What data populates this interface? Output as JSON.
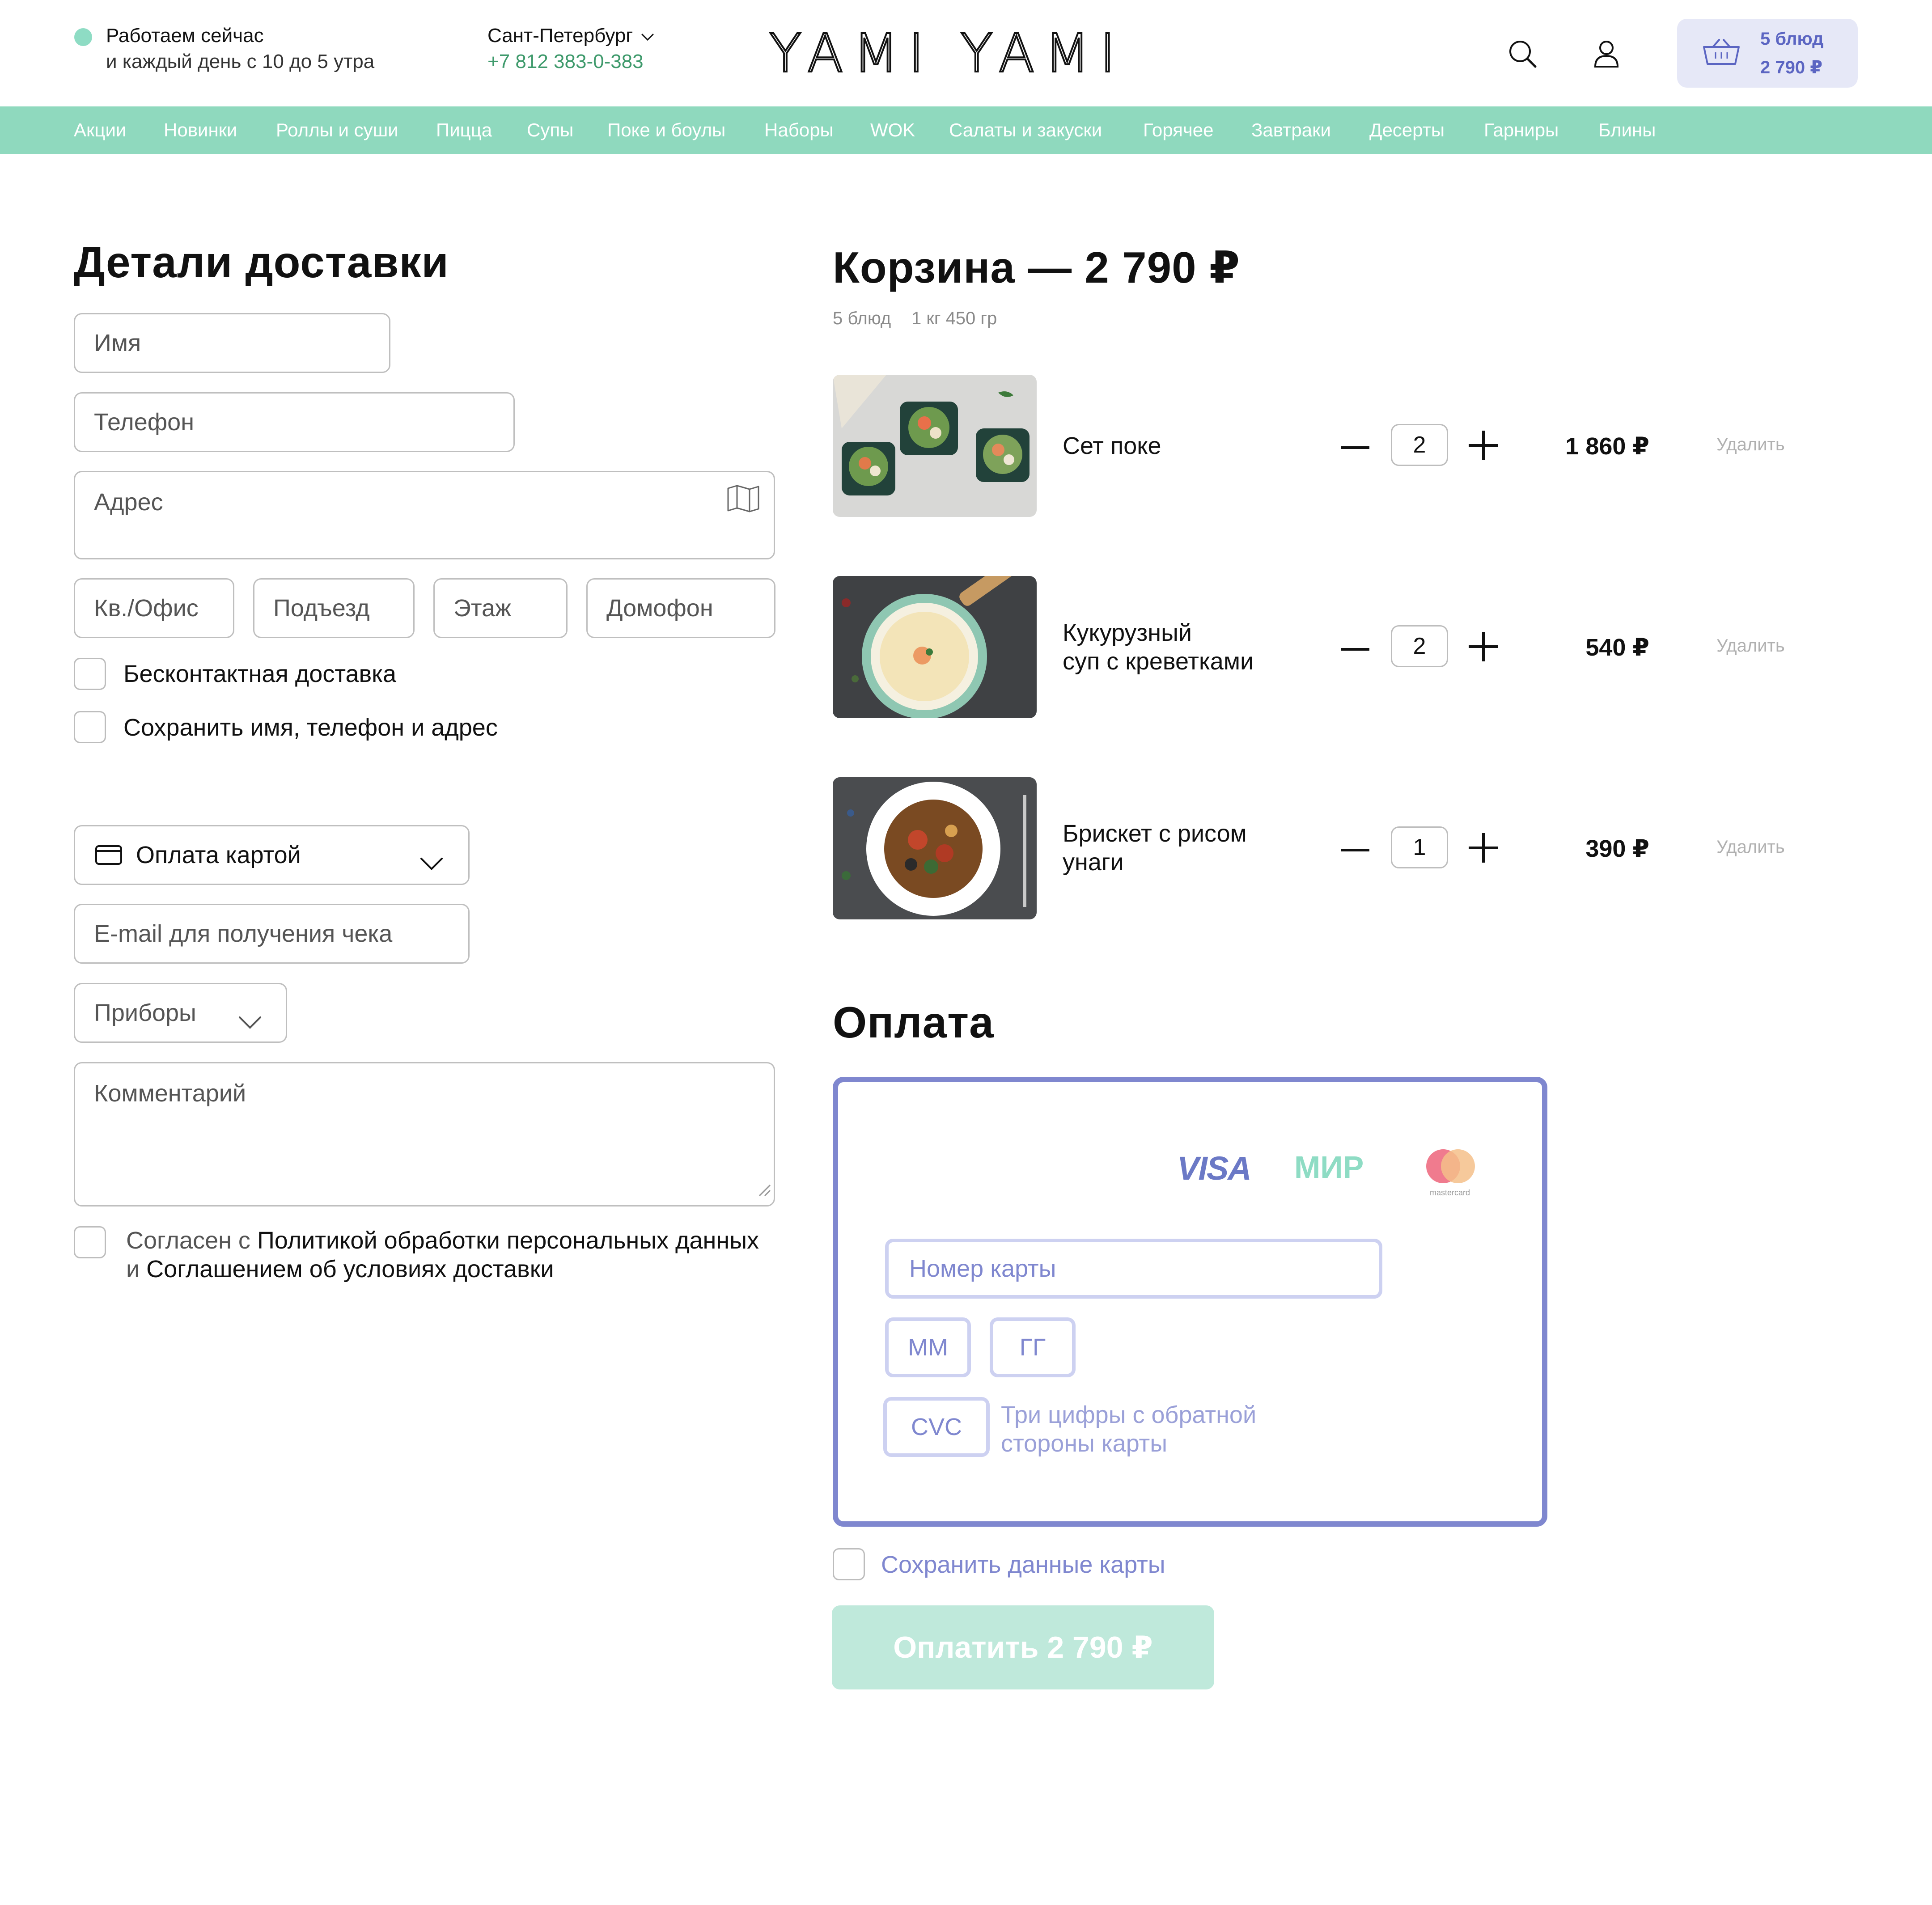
{
  "header": {
    "status_title": "Работаем сейчас",
    "status_sub": "и каждый день с 10 до 5 утра",
    "city": "Сант-Петербург",
    "phone": "+7 812 383-0-383",
    "logo_text": "YAMI YAMI",
    "cart_count": "5 блюд",
    "cart_total": "2 790 ₽"
  },
  "nav": [
    "Акции",
    "Новинки",
    "Роллы и суши",
    "Пицца",
    "Супы",
    "Поке и боулы",
    "Наборы",
    "WOK",
    "Салаты и закуски",
    "Горячее",
    "Завтраки",
    "Десерты",
    "Гарниры",
    "Блины"
  ],
  "delivery": {
    "title": "Детали доставки",
    "name_placeholder": "Имя",
    "phone_placeholder": "Телефон",
    "address_placeholder": "Адрес",
    "apt_placeholder": "Кв./Офис",
    "entrance_placeholder": "Подъезд",
    "floor_placeholder": "Этаж",
    "intercom_placeholder": "Домофон",
    "contactless_label": "Бесконтактная доставка",
    "save_label": "Сохранить имя, телефон и адрес",
    "payment_method": "Оплата картой",
    "email_placeholder": "E-mail для получения чека",
    "cutlery": "Приборы",
    "comment_placeholder": "Комментарий",
    "agree_prefix": "Согласен с ",
    "agree_policy": "Политикой обработки персональных данных",
    "agree_mid": " и ",
    "agree_terms": "Соглашением об условиях доставки"
  },
  "cart": {
    "title": "Корзина — 2 790 ₽",
    "meta_dishes": "5 блюд",
    "meta_weight": "1 кг 450 гр",
    "delete_label": "Удалить",
    "items": [
      {
        "name_line1": "Сет поке",
        "name_line2": "",
        "qty": "2",
        "price": "1 860 ₽"
      },
      {
        "name_line1": "Кукурузный",
        "name_line2": "суп с креветками",
        "qty": "2",
        "price": "540 ₽"
      },
      {
        "name_line1": "Брискет с рисом",
        "name_line2": "унаги",
        "qty": "1",
        "price": "390 ₽"
      }
    ]
  },
  "payment": {
    "title": "Оплата",
    "visa": "VISA",
    "mir": "МИР",
    "mastercard": "mastercard",
    "card_number_placeholder": "Номер карты",
    "month_placeholder": "ММ",
    "year_placeholder": "ГГ",
    "cvc_placeholder": "CVC",
    "cvc_hint_line1": "Три цифры с обратной",
    "cvc_hint_line2": "стороны карты",
    "save_card_label": "Сохранить данные карты",
    "pay_button": "Оплатить 2 790 ₽"
  },
  "colors": {
    "accent_green": "#8fd9be",
    "accent_purple": "#7f87cf",
    "text_dark": "#111111",
    "phone_green": "#3f9a6c"
  }
}
